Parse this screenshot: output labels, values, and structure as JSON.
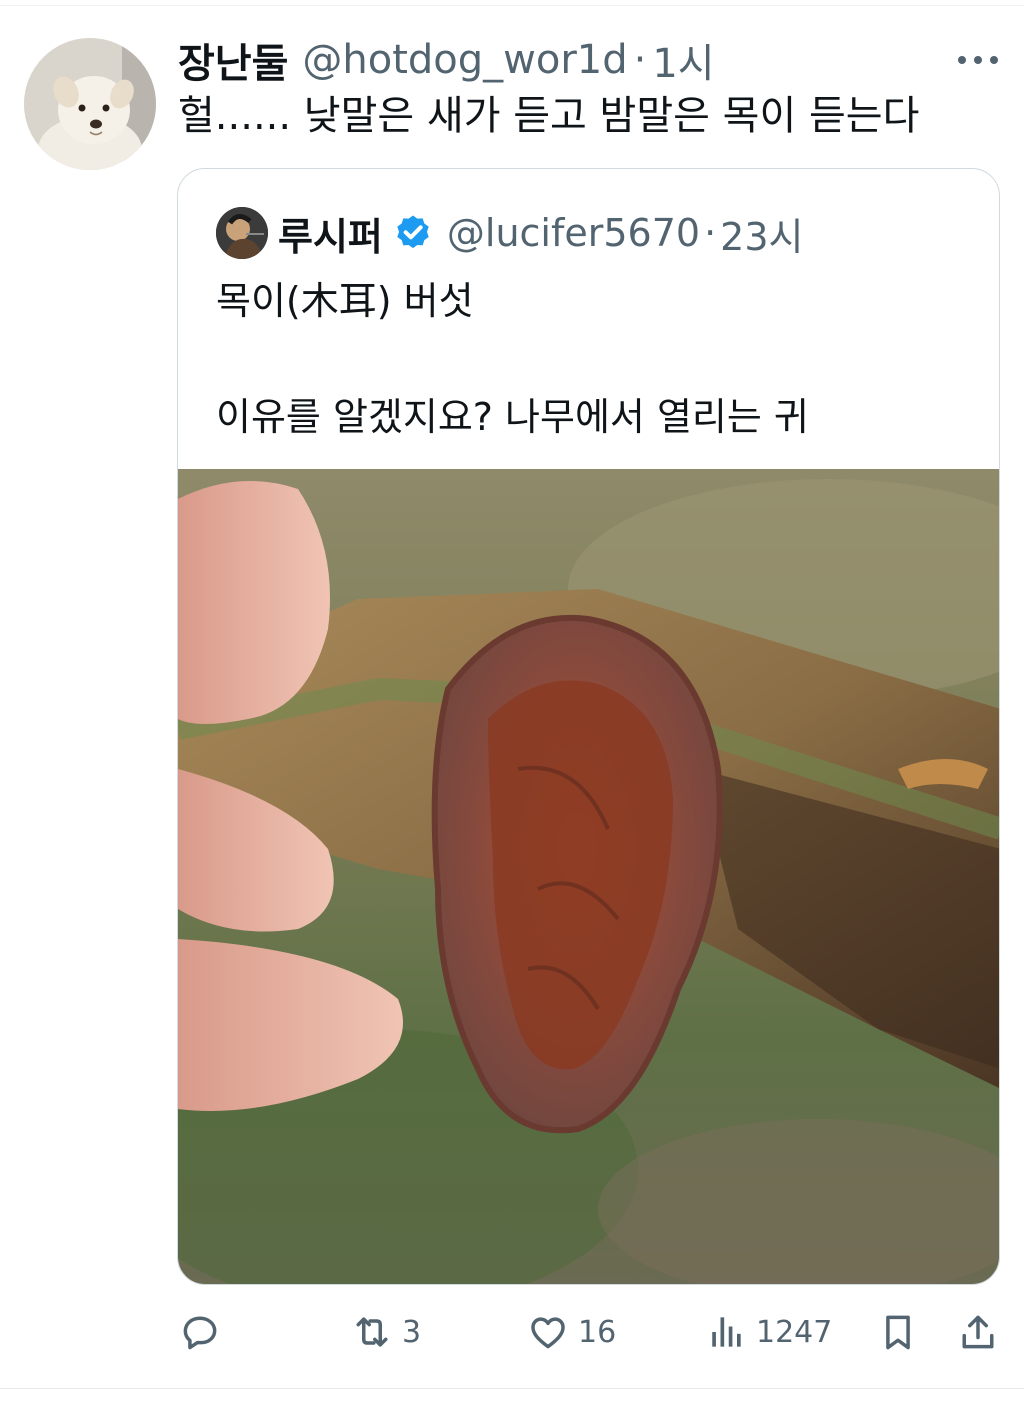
{
  "tweet": {
    "display_name": "장난둘",
    "handle": "@hotdog_wor1d",
    "separator": "·",
    "time": "1시",
    "text": "헐...... 낮말은 새가 듣고 밤말은 목이 듣는다"
  },
  "quoted_tweet": {
    "display_name": "루시퍼",
    "verified": true,
    "handle": "@lucifer5670",
    "separator": "·",
    "time": "23시",
    "text_line1": "목이(木耳) 버섯",
    "text_line2": "이유를 알겠지요?  나무에서 열리는 귀"
  },
  "actions": {
    "reply": {
      "icon": "reply-icon",
      "count": ""
    },
    "retweet": {
      "icon": "retweet-icon",
      "count": "3"
    },
    "like": {
      "icon": "heart-icon",
      "count": "16"
    },
    "views": {
      "icon": "views-icon",
      "count": "1247"
    },
    "bookmark": {
      "icon": "bookmark-icon"
    },
    "share": {
      "icon": "share-icon"
    }
  },
  "colors": {
    "text_primary": "#0f1419",
    "text_secondary": "#536471",
    "border": "#cfd9de",
    "verified": "#1d9bf0"
  }
}
